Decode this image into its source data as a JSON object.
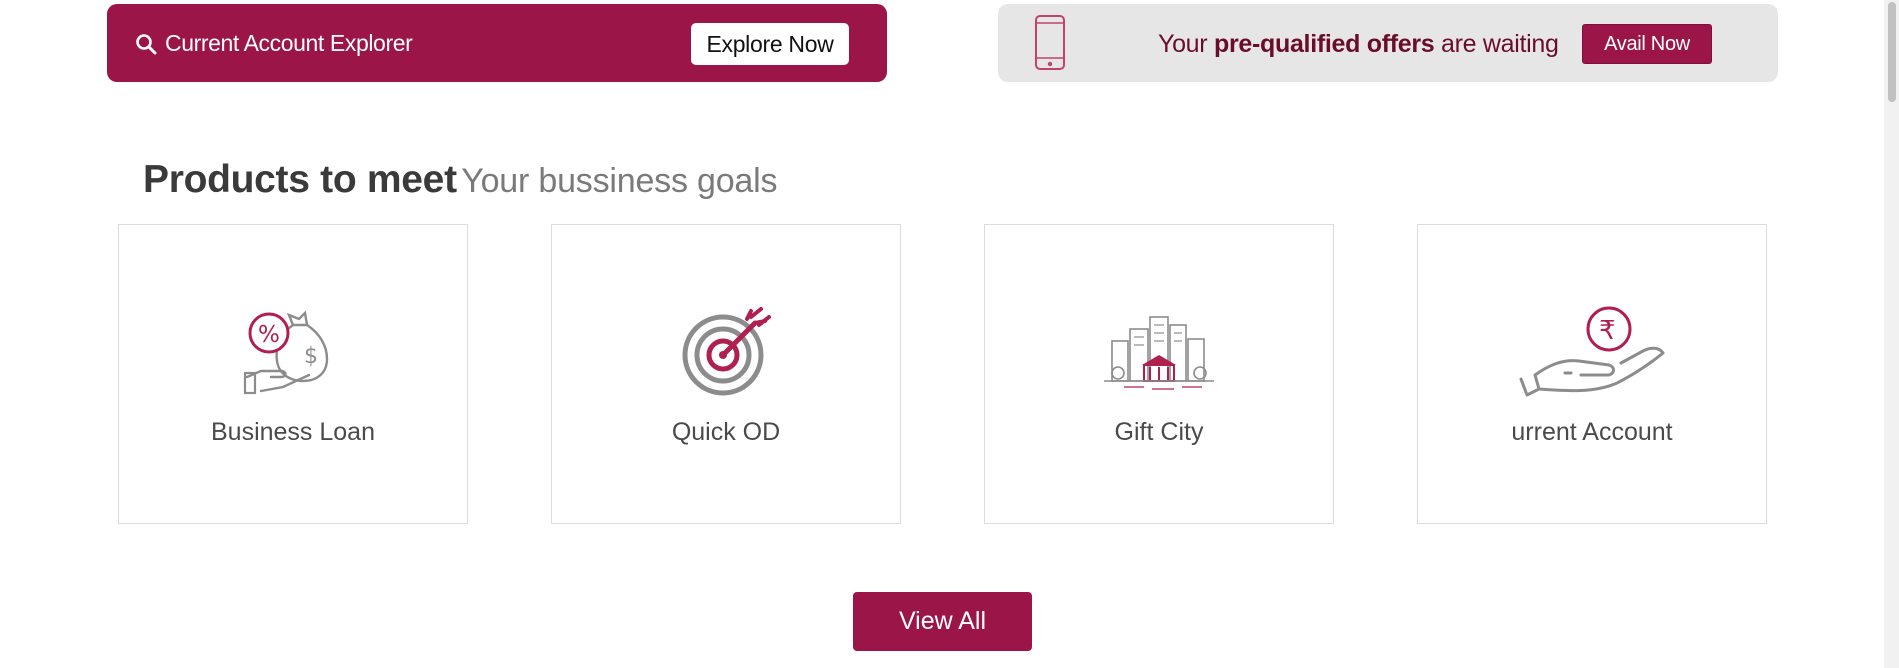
{
  "banners": {
    "left": {
      "title": "Current Account Explorer",
      "button_label": "Explore Now"
    },
    "right": {
      "text_before": "Your ",
      "text_bold": "pre-qualified offers",
      "text_after": " are waiting",
      "button_label": "Avail Now"
    }
  },
  "section": {
    "heading_strong": "Products to meet",
    "heading_light": "Your bussiness goals"
  },
  "products": [
    {
      "label": "Business Loan",
      "icon": "money-bag-hand-icon"
    },
    {
      "label": "Quick OD",
      "icon": "target-arrow-icon"
    },
    {
      "label": "Gift City",
      "icon": "city-buildings-icon"
    },
    {
      "label": "urrent Account",
      "icon": "rupee-hand-icon"
    }
  ],
  "view_all_label": "View All",
  "colors": {
    "brand": "#9b1548",
    "banner_grey": "#e6e6e6",
    "icon_grey": "#8c8c8c"
  }
}
